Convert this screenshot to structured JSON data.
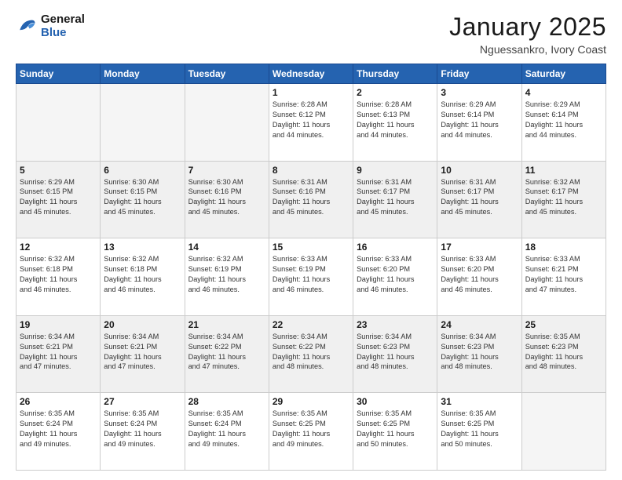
{
  "header": {
    "logo_line1": "General",
    "logo_line2": "Blue",
    "month": "January 2025",
    "location": "Nguessankro, Ivory Coast"
  },
  "days_of_week": [
    "Sunday",
    "Monday",
    "Tuesday",
    "Wednesday",
    "Thursday",
    "Friday",
    "Saturday"
  ],
  "weeks": [
    [
      {
        "day": "",
        "info": ""
      },
      {
        "day": "",
        "info": ""
      },
      {
        "day": "",
        "info": ""
      },
      {
        "day": "1",
        "info": "Sunrise: 6:28 AM\nSunset: 6:12 PM\nDaylight: 11 hours\nand 44 minutes."
      },
      {
        "day": "2",
        "info": "Sunrise: 6:28 AM\nSunset: 6:13 PM\nDaylight: 11 hours\nand 44 minutes."
      },
      {
        "day": "3",
        "info": "Sunrise: 6:29 AM\nSunset: 6:14 PM\nDaylight: 11 hours\nand 44 minutes."
      },
      {
        "day": "4",
        "info": "Sunrise: 6:29 AM\nSunset: 6:14 PM\nDaylight: 11 hours\nand 44 minutes."
      }
    ],
    [
      {
        "day": "5",
        "info": "Sunrise: 6:29 AM\nSunset: 6:15 PM\nDaylight: 11 hours\nand 45 minutes."
      },
      {
        "day": "6",
        "info": "Sunrise: 6:30 AM\nSunset: 6:15 PM\nDaylight: 11 hours\nand 45 minutes."
      },
      {
        "day": "7",
        "info": "Sunrise: 6:30 AM\nSunset: 6:16 PM\nDaylight: 11 hours\nand 45 minutes."
      },
      {
        "day": "8",
        "info": "Sunrise: 6:31 AM\nSunset: 6:16 PM\nDaylight: 11 hours\nand 45 minutes."
      },
      {
        "day": "9",
        "info": "Sunrise: 6:31 AM\nSunset: 6:17 PM\nDaylight: 11 hours\nand 45 minutes."
      },
      {
        "day": "10",
        "info": "Sunrise: 6:31 AM\nSunset: 6:17 PM\nDaylight: 11 hours\nand 45 minutes."
      },
      {
        "day": "11",
        "info": "Sunrise: 6:32 AM\nSunset: 6:17 PM\nDaylight: 11 hours\nand 45 minutes."
      }
    ],
    [
      {
        "day": "12",
        "info": "Sunrise: 6:32 AM\nSunset: 6:18 PM\nDaylight: 11 hours\nand 46 minutes."
      },
      {
        "day": "13",
        "info": "Sunrise: 6:32 AM\nSunset: 6:18 PM\nDaylight: 11 hours\nand 46 minutes."
      },
      {
        "day": "14",
        "info": "Sunrise: 6:32 AM\nSunset: 6:19 PM\nDaylight: 11 hours\nand 46 minutes."
      },
      {
        "day": "15",
        "info": "Sunrise: 6:33 AM\nSunset: 6:19 PM\nDaylight: 11 hours\nand 46 minutes."
      },
      {
        "day": "16",
        "info": "Sunrise: 6:33 AM\nSunset: 6:20 PM\nDaylight: 11 hours\nand 46 minutes."
      },
      {
        "day": "17",
        "info": "Sunrise: 6:33 AM\nSunset: 6:20 PM\nDaylight: 11 hours\nand 46 minutes."
      },
      {
        "day": "18",
        "info": "Sunrise: 6:33 AM\nSunset: 6:21 PM\nDaylight: 11 hours\nand 47 minutes."
      }
    ],
    [
      {
        "day": "19",
        "info": "Sunrise: 6:34 AM\nSunset: 6:21 PM\nDaylight: 11 hours\nand 47 minutes."
      },
      {
        "day": "20",
        "info": "Sunrise: 6:34 AM\nSunset: 6:21 PM\nDaylight: 11 hours\nand 47 minutes."
      },
      {
        "day": "21",
        "info": "Sunrise: 6:34 AM\nSunset: 6:22 PM\nDaylight: 11 hours\nand 47 minutes."
      },
      {
        "day": "22",
        "info": "Sunrise: 6:34 AM\nSunset: 6:22 PM\nDaylight: 11 hours\nand 48 minutes."
      },
      {
        "day": "23",
        "info": "Sunrise: 6:34 AM\nSunset: 6:23 PM\nDaylight: 11 hours\nand 48 minutes."
      },
      {
        "day": "24",
        "info": "Sunrise: 6:34 AM\nSunset: 6:23 PM\nDaylight: 11 hours\nand 48 minutes."
      },
      {
        "day": "25",
        "info": "Sunrise: 6:35 AM\nSunset: 6:23 PM\nDaylight: 11 hours\nand 48 minutes."
      }
    ],
    [
      {
        "day": "26",
        "info": "Sunrise: 6:35 AM\nSunset: 6:24 PM\nDaylight: 11 hours\nand 49 minutes."
      },
      {
        "day": "27",
        "info": "Sunrise: 6:35 AM\nSunset: 6:24 PM\nDaylight: 11 hours\nand 49 minutes."
      },
      {
        "day": "28",
        "info": "Sunrise: 6:35 AM\nSunset: 6:24 PM\nDaylight: 11 hours\nand 49 minutes."
      },
      {
        "day": "29",
        "info": "Sunrise: 6:35 AM\nSunset: 6:25 PM\nDaylight: 11 hours\nand 49 minutes."
      },
      {
        "day": "30",
        "info": "Sunrise: 6:35 AM\nSunset: 6:25 PM\nDaylight: 11 hours\nand 50 minutes."
      },
      {
        "day": "31",
        "info": "Sunrise: 6:35 AM\nSunset: 6:25 PM\nDaylight: 11 hours\nand 50 minutes."
      },
      {
        "day": "",
        "info": ""
      }
    ]
  ]
}
